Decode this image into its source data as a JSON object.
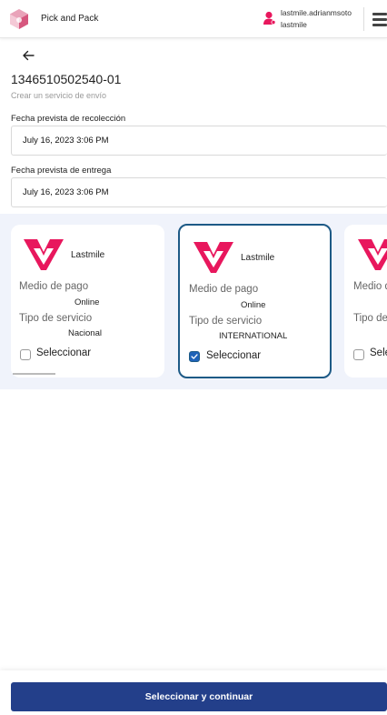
{
  "header": {
    "app_title": "Pick and Pack",
    "user_name": "lastmile.adrianmsoto",
    "user_org": "lastmile",
    "icons": {
      "logo": "app-logo-icon",
      "user": "user-icon",
      "menu": "hamburger-menu-icon"
    }
  },
  "page": {
    "back_icon": "arrow-left-icon",
    "order_id": "1346510502540-01",
    "subtitle": "Crear un servicio de envío"
  },
  "form": {
    "pickup_label": "Fecha prevista de recolección",
    "pickup_value": "July 16, 2023 3:06 PM",
    "delivery_label": "Fecha prevista de entrega",
    "delivery_value": "July 16, 2023 3:06 PM"
  },
  "services": [
    {
      "carrier": "Lastmile",
      "payment_label": "Medio de pago",
      "payment_value": "Online",
      "service_label": "Tipo de servicio",
      "service_value": "Nacional",
      "select_label": "Seleccionar",
      "selected": false
    },
    {
      "carrier": "Lastmile",
      "payment_label": "Medio de pago",
      "payment_value": "Online",
      "service_label": "Tipo de servicio",
      "service_value": "INTERNATIONAL",
      "select_label": "Seleccionar",
      "selected": true
    },
    {
      "carrier": "",
      "payment_label": "Medio d",
      "payment_value": "",
      "service_label": "Tipo de",
      "service_value": "",
      "select_label": "Sele",
      "selected": false
    }
  ],
  "footer": {
    "cta_label": "Seleccionar y continuar"
  },
  "colors": {
    "brand_pink": "#e8175d",
    "primary_blue": "#233f8a",
    "selected_border": "#1d5a86",
    "carousel_bg": "#f0f3fb"
  }
}
